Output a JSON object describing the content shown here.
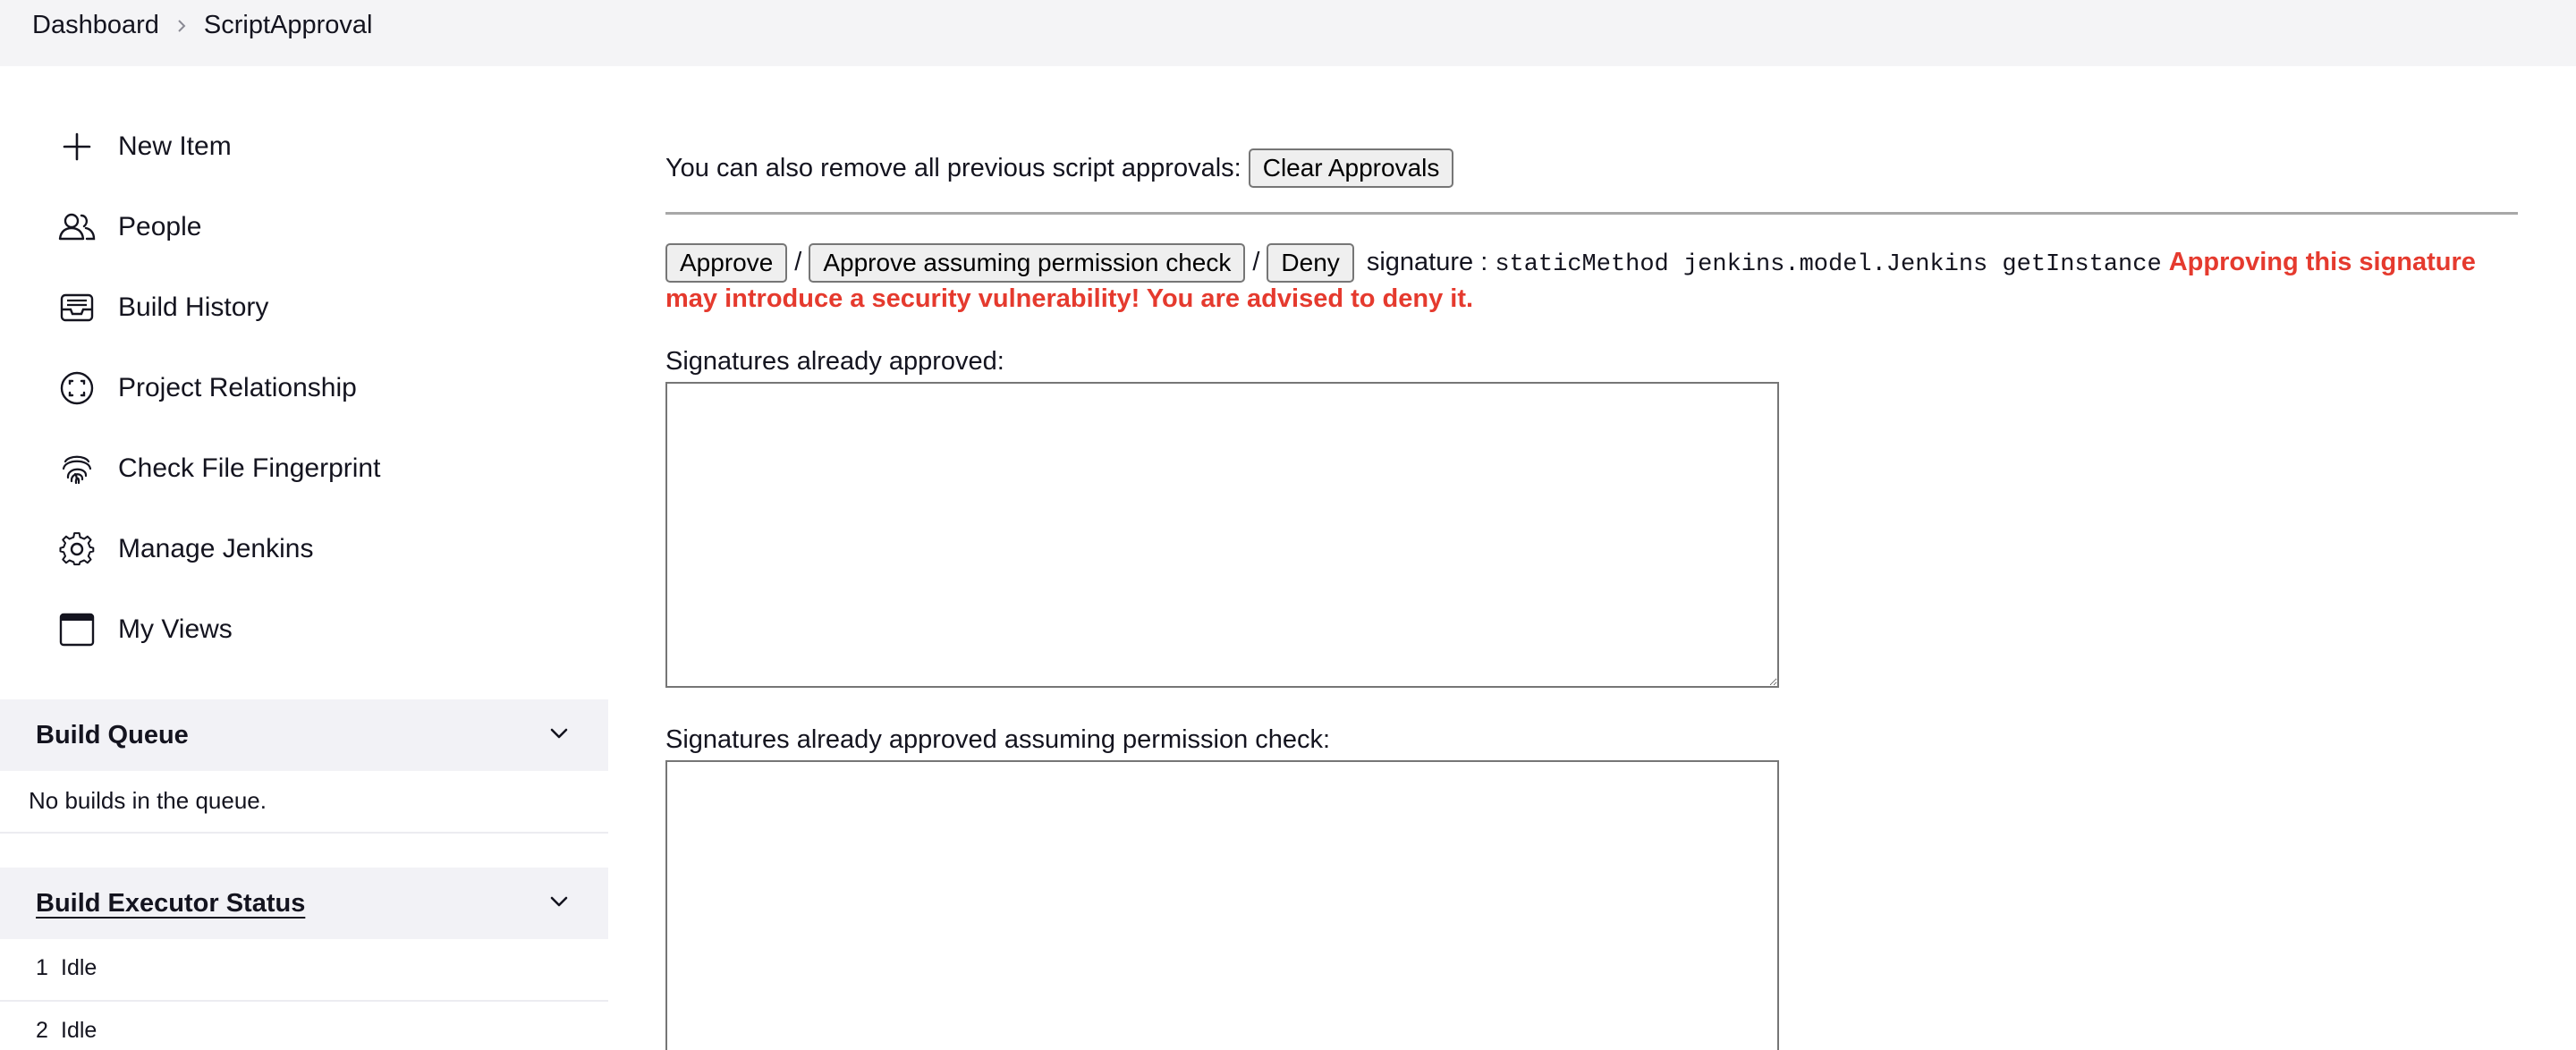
{
  "breadcrumb": {
    "items": [
      "Dashboard",
      "ScriptApproval"
    ]
  },
  "sidebar": {
    "items": [
      {
        "label": "New Item",
        "icon": "plus-icon"
      },
      {
        "label": "People",
        "icon": "people-icon"
      },
      {
        "label": "Build History",
        "icon": "inbox-icon"
      },
      {
        "label": "Project Relationship",
        "icon": "relationship-icon"
      },
      {
        "label": "Check File Fingerprint",
        "icon": "fingerprint-icon"
      },
      {
        "label": "Manage Jenkins",
        "icon": "gear-icon"
      },
      {
        "label": "My Views",
        "icon": "window-icon"
      }
    ]
  },
  "build_queue": {
    "title": "Build Queue",
    "empty_text": "No builds in the queue."
  },
  "executor_status": {
    "title": "Build Executor Status",
    "rows": [
      {
        "num": "1",
        "status": "Idle"
      },
      {
        "num": "2",
        "status": "Idle"
      }
    ]
  },
  "main": {
    "clear_text": "You can also remove all previous script approvals:",
    "clear_button": "Clear Approvals",
    "approve_button": "Approve",
    "approve_perm_button": "Approve assuming permission check",
    "deny_button": "Deny",
    "separator": "/",
    "signature_label": "signature :",
    "signature_value": "staticMethod jenkins.model.Jenkins getInstance",
    "warning_part1": "Approving this signature",
    "warning_part2": "may introduce a security vulnerability! You are advised to deny it.",
    "approved_label": "Signatures already approved:",
    "approved_value": "",
    "approved_perm_label": "Signatures already approved assuming permission check:",
    "approved_perm_value": ""
  },
  "colors": {
    "topbar_bg": "#f4f4f6",
    "warning": "#e53a2e",
    "panel_bg": "#f2f2f6"
  }
}
